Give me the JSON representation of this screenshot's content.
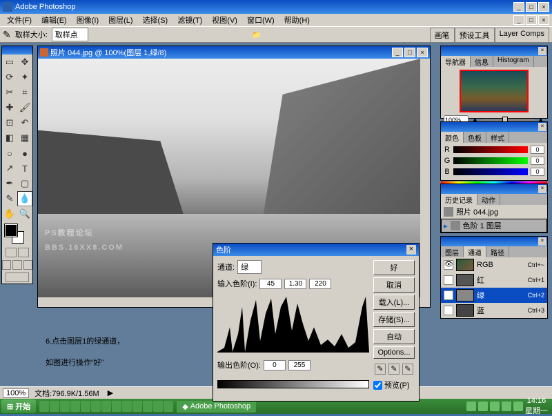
{
  "app": {
    "title": "Adobe Photoshop"
  },
  "menus": [
    "文件(F)",
    "编辑(E)",
    "图像(I)",
    "图层(L)",
    "选择(S)",
    "滤镜(T)",
    "视图(V)",
    "窗口(W)",
    "帮助(H)"
  ],
  "options": {
    "label": "取样大小:",
    "value": "取样点",
    "tabs": [
      "画笔",
      "预设工具",
      "Layer Comps"
    ]
  },
  "document": {
    "title": "照片 044.jpg @ 100%(图层 1,绿/8)",
    "watermark1": "PS教程论坛",
    "watermark2": "BBS.16XX8.COM"
  },
  "instruction": {
    "line1": "6.点击图层1的绿通道，",
    "line2": "如图进行操作“好”"
  },
  "navigator": {
    "tabs": [
      "导航器",
      "信息",
      "Histogram"
    ],
    "zoom": "100%"
  },
  "color": {
    "tabs": [
      "颜色",
      "色板",
      "样式"
    ],
    "rows": [
      {
        "lbl": "R",
        "val": "0",
        "grad": "linear-gradient(90deg,#000,#f00)"
      },
      {
        "lbl": "G",
        "val": "0",
        "grad": "linear-gradient(90deg,#000,#0f0)"
      },
      {
        "lbl": "B",
        "val": "0",
        "grad": "linear-gradient(90deg,#000,#00f)"
      }
    ]
  },
  "history": {
    "tabs": [
      "历史记录",
      "动作"
    ],
    "items": [
      {
        "label": "照片 044.jpg"
      },
      {
        "label": "色阶 1 图层"
      }
    ]
  },
  "channels": {
    "tabs": [
      "图层",
      "通道",
      "路径"
    ],
    "rows": [
      {
        "name": "RGB",
        "sc": "Ctrl+~",
        "color": "linear-gradient(135deg,#2a5a3a,#7a5a3a)",
        "eye": true
      },
      {
        "name": "红",
        "sc": "Ctrl+1",
        "color": "#555",
        "eye": false
      },
      {
        "name": "绿",
        "sc": "Ctrl+2",
        "color": "#888",
        "eye": true,
        "sel": true
      },
      {
        "name": "蓝",
        "sc": "Ctrl+3",
        "color": "#444",
        "eye": false
      }
    ]
  },
  "levels": {
    "title": "色阶",
    "channel_lbl": "通道:",
    "channel_val": "绿",
    "input_lbl": "输入色阶(I):",
    "in": [
      "45",
      "1.30",
      "220"
    ],
    "output_lbl": "输出色阶(O):",
    "out": [
      "0",
      "255"
    ],
    "buttons": [
      "好",
      "取消",
      "载入(L)...",
      "存储(S)...",
      "自动",
      "Options..."
    ],
    "preview": "预览(P)"
  },
  "status": {
    "zoom": "100%",
    "doc": "文档:796.9K/1.56M"
  },
  "taskbar": {
    "start": "开始",
    "task": "Adobe Photoshop",
    "time": "14:16",
    "day": "星期一"
  }
}
